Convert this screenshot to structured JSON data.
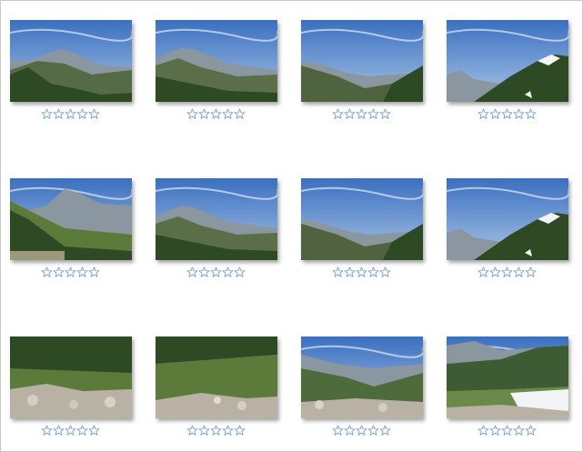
{
  "gallery": {
    "photos": [
      {
        "rating": 0,
        "view": "peak-left"
      },
      {
        "rating": 0,
        "view": "peak-left-wide"
      },
      {
        "rating": 0,
        "view": "valley"
      },
      {
        "rating": 0,
        "view": "snow-right"
      },
      {
        "rating": 0,
        "view": "forest-peak"
      },
      {
        "rating": 0,
        "view": "peak-left-wide"
      },
      {
        "rating": 0,
        "view": "valley"
      },
      {
        "rating": 0,
        "view": "snow-right"
      },
      {
        "rating": 0,
        "view": "rocks-forest"
      },
      {
        "rating": 0,
        "view": "rocks-forest-2"
      },
      {
        "rating": 0,
        "view": "rocks-valley"
      },
      {
        "rating": 0,
        "view": "rocks-snow"
      }
    ],
    "max_rating": 5
  },
  "colors": {
    "star_fill": "#ffffff",
    "star_stroke": "#7aa3cf",
    "sky_top": "#3b6fbf",
    "sky_bottom": "#a9c6e8",
    "mountain_far": "#8a96a0",
    "forest": "#2d4a25",
    "forest_light": "#5c7a3a",
    "rock": "#b9b2a4",
    "snow": "#f2f4f6"
  }
}
